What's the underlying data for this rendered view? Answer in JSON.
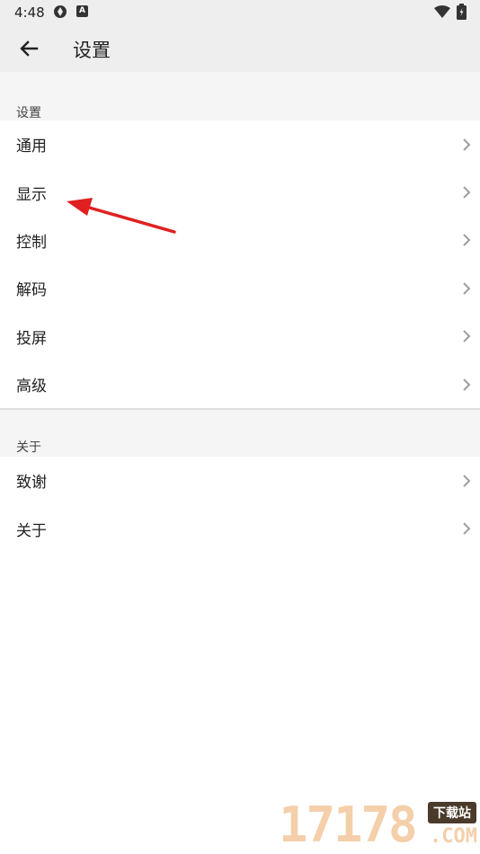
{
  "status_bar": {
    "time": "4:48",
    "icons": [
      "sync-icon",
      "a-badge-icon",
      "wifi-icon",
      "battery-icon"
    ],
    "badge_letter": "A"
  },
  "appbar": {
    "back_icon": "arrow-left-icon",
    "title": "设置"
  },
  "sections": [
    {
      "header": "设置",
      "items": [
        {
          "label": "通用"
        },
        {
          "label": "显示"
        },
        {
          "label": "控制"
        },
        {
          "label": "解码"
        },
        {
          "label": "投屏"
        },
        {
          "label": "高级"
        }
      ]
    },
    {
      "header": "关于",
      "items": [
        {
          "label": "致谢"
        },
        {
          "label": "关于"
        }
      ]
    }
  ],
  "annotation": {
    "type": "red-arrow",
    "color": "#e02020"
  },
  "watermark": {
    "digits": "17178",
    "badge": "下载站",
    "suffix": ".COM"
  },
  "colors": {
    "appbar_bg": "#eeeeee",
    "section_bg": "#f5f5f5",
    "text": "#212121",
    "chevron": "#9e9e9e"
  }
}
